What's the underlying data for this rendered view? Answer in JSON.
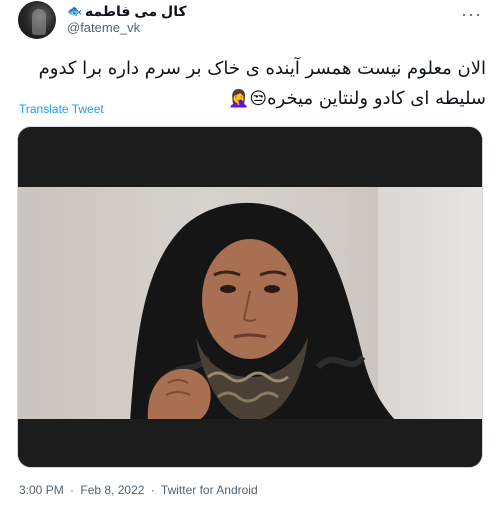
{
  "user": {
    "display_name": "کال می فاطمه",
    "badge_icon": "fish-icon",
    "handle": "@fateme_vk"
  },
  "tweet": {
    "text_line1": "الان معلوم نیست همسر آینده ی خاک بر سرم داره برا کدوم",
    "text_line2": "سلیطه ای کادو ولنتاین میخره",
    "emojis": "😒🤦‍♀️",
    "translate_label": "Translate Tweet"
  },
  "meta": {
    "time": "3:00 PM",
    "sep1": "·",
    "date": "Feb 8, 2022",
    "sep2": "·",
    "source": "Twitter for Android"
  },
  "colors": {
    "link": "#1d9bf0",
    "secondary": "#536471",
    "text": "#0f1419"
  }
}
